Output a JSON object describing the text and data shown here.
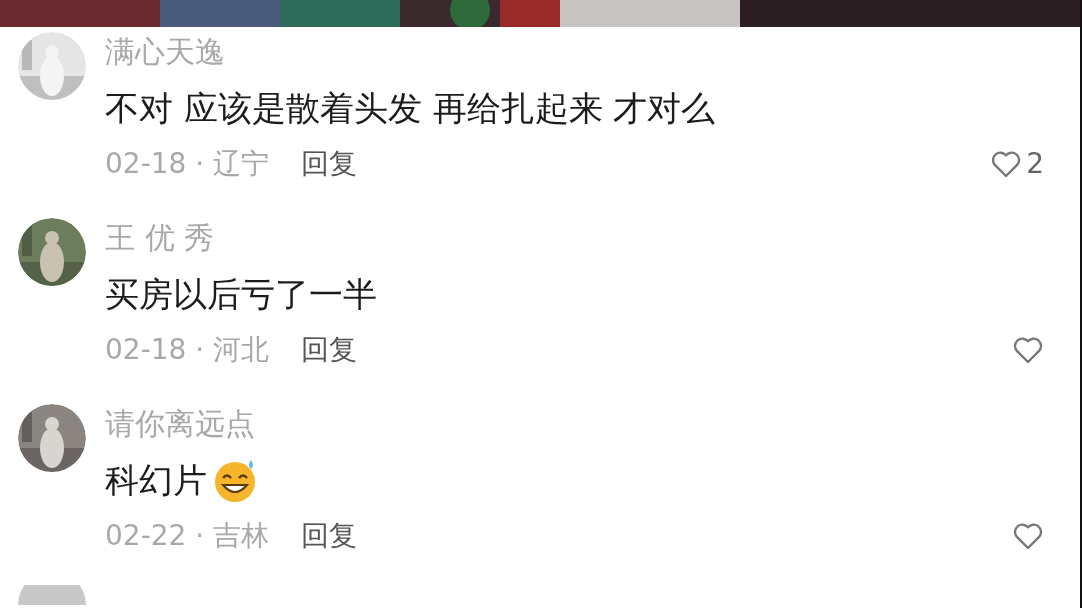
{
  "comments": [
    {
      "author": "满心天逸",
      "text": "不对 应该是散着头发 再给扎起来 才对么",
      "emoji": false,
      "meta": "02-18 · 辽宁",
      "reply": "回复",
      "likes": "2"
    },
    {
      "author": "王 优 秀",
      "text": "买房以后亏了一半",
      "emoji": false,
      "meta": "02-18 · 河北",
      "reply": "回复"
    },
    {
      "author": "请你离远点",
      "text": "科幻片",
      "emoji": true,
      "meta": "02-22 · 吉林",
      "reply": "回复"
    }
  ]
}
